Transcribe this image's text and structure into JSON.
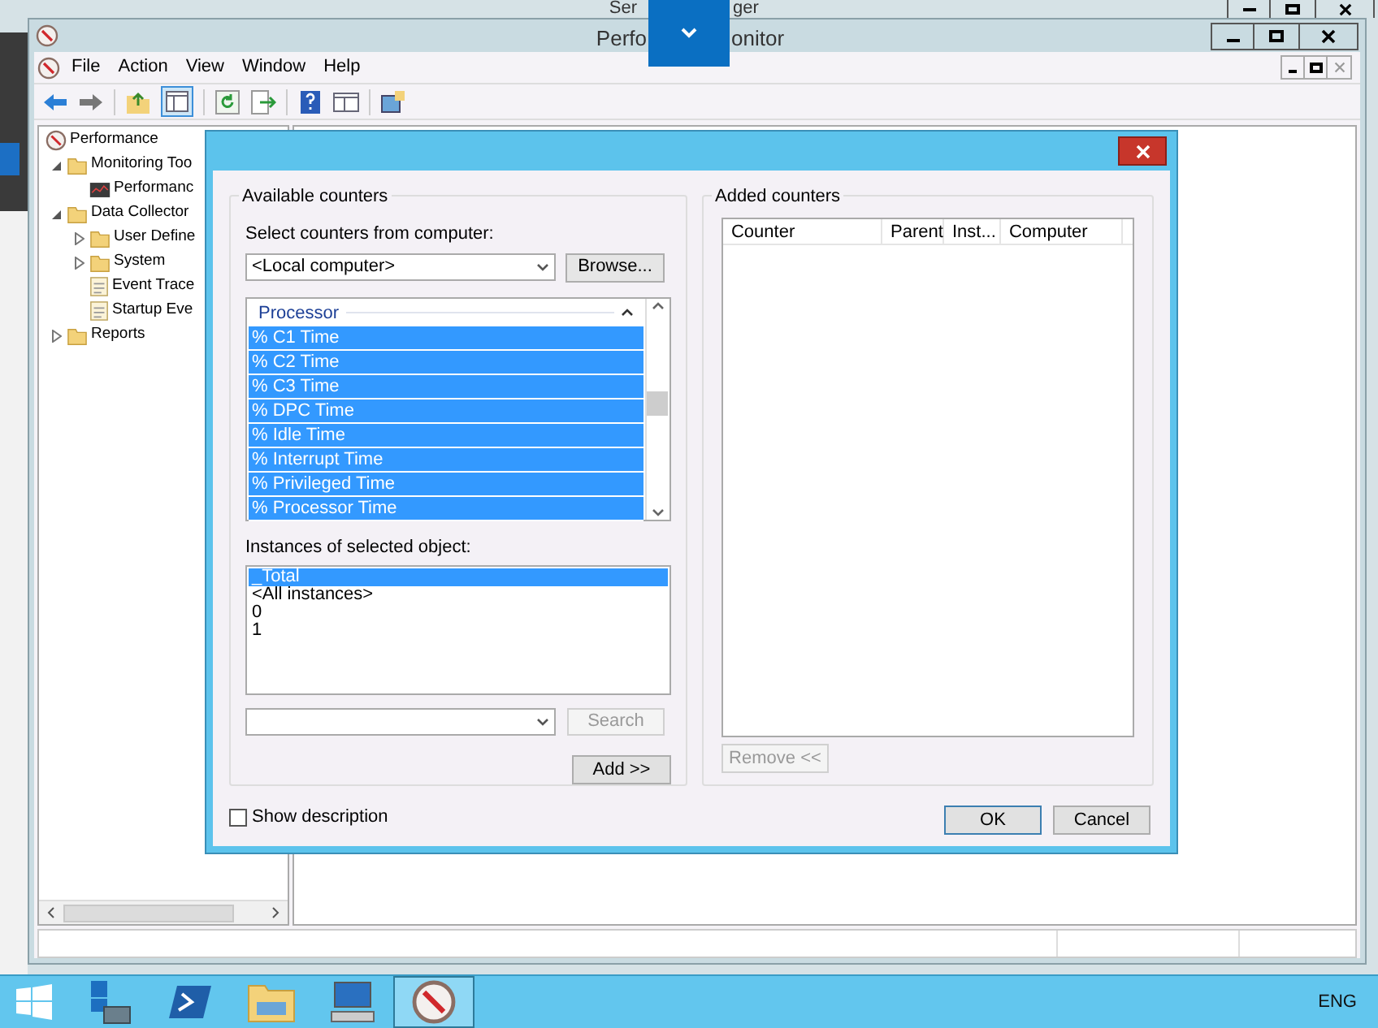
{
  "background_window": {
    "title_parts": [
      "Ser",
      "ger"
    ]
  },
  "window": {
    "title_parts": [
      "Perfo",
      "onitor"
    ]
  },
  "menu": [
    "File",
    "Action",
    "View",
    "Window",
    "Help"
  ],
  "tree": [
    {
      "label": "Performance",
      "kind": "gauge",
      "children": [
        {
          "label": "Monitoring Too",
          "kind": "folder",
          "expanded": true,
          "children": [
            {
              "label": "Performanc",
              "kind": "chart"
            }
          ]
        },
        {
          "label": "Data Collector",
          "kind": "folder",
          "expanded": true,
          "children": [
            {
              "label": "User Define",
              "kind": "folder",
              "expanded": false
            },
            {
              "label": "System",
              "kind": "folder",
              "expanded": false
            },
            {
              "label": "Event Trace",
              "kind": "log"
            },
            {
              "label": "Startup Eve",
              "kind": "log"
            }
          ]
        },
        {
          "label": "Reports",
          "kind": "folder",
          "expanded": false
        }
      ]
    }
  ],
  "dialog": {
    "available": {
      "title": "Available counters",
      "computer_label": "Select counters from computer:",
      "computer_value": "<Local computer>",
      "browse": "Browse...",
      "category": "Processor",
      "counters": [
        {
          "label": "% C1 Time",
          "selected": true
        },
        {
          "label": "% C2 Time",
          "selected": true
        },
        {
          "label": "% C3 Time",
          "selected": true
        },
        {
          "label": "% DPC Time",
          "selected": true
        },
        {
          "label": "% Idle Time",
          "selected": true
        },
        {
          "label": "% Interrupt Time",
          "selected": true
        },
        {
          "label": "% Privileged Time",
          "selected": true
        },
        {
          "label": "% Processor Time",
          "selected": true
        }
      ],
      "instances_label": "Instances of selected object:",
      "instances": [
        {
          "label": "_Total",
          "selected": true
        },
        {
          "label": "<All instances>",
          "selected": false
        },
        {
          "label": "0",
          "selected": false
        },
        {
          "label": "1",
          "selected": false
        }
      ],
      "search": {
        "label": "Search",
        "disabled": true
      },
      "add": "Add >>"
    },
    "added": {
      "title": "Added counters",
      "columns": [
        "Counter",
        "Parent",
        "Inst...",
        "Computer"
      ],
      "remove": {
        "label": "Remove <<",
        "disabled": true
      }
    },
    "show_description": {
      "label": "Show description",
      "checked": false
    },
    "buttons": [
      "OK",
      "Cancel"
    ]
  },
  "taskbar": {
    "items": [
      {
        "kind": "server",
        "selected": false
      },
      {
        "kind": "shell",
        "selected": false
      },
      {
        "kind": "explorer",
        "selected": false
      },
      {
        "kind": "remote",
        "selected": false
      },
      {
        "kind": "gauge",
        "selected": true
      }
    ],
    "language": "ENG"
  }
}
